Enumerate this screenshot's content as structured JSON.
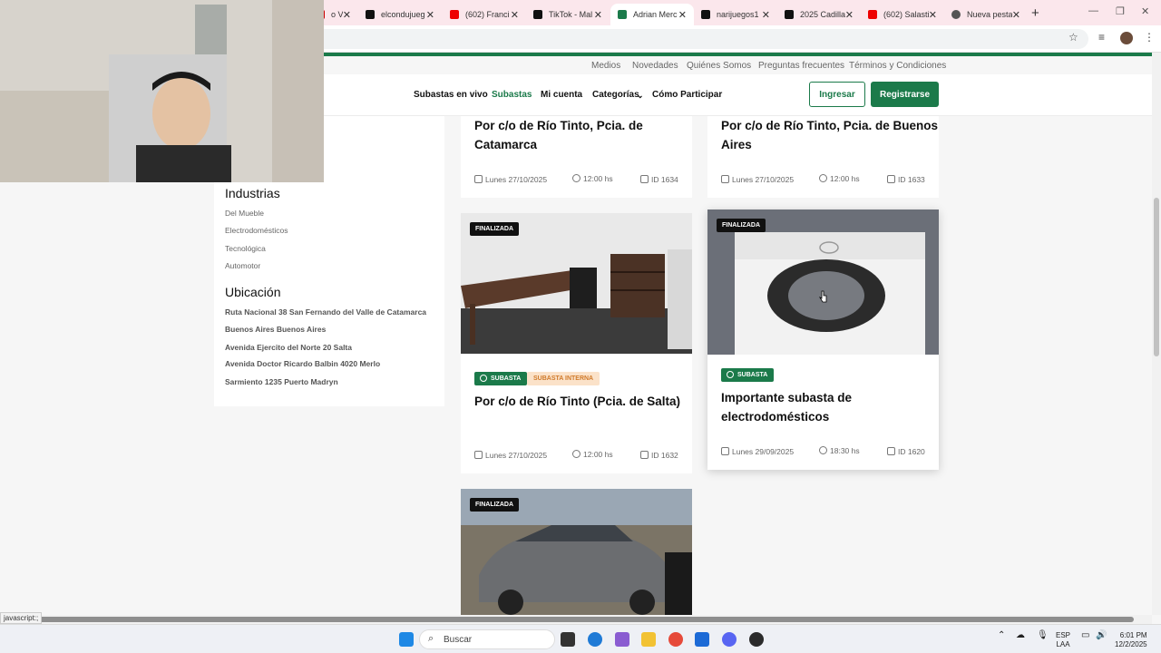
{
  "browser": {
    "tabs": [
      {
        "label": "o V",
        "color": "#c00",
        "active": false
      },
      {
        "label": "elcondujueg",
        "color": "#111",
        "active": false
      },
      {
        "label": "(602) Franci",
        "color": "#e00",
        "active": false
      },
      {
        "label": "TikTok - Mal",
        "color": "#111",
        "active": false
      },
      {
        "label": "Adrian Merc",
        "color": "#1b7a4a",
        "active": true
      },
      {
        "label": "narijuegos1",
        "color": "#111",
        "active": false
      },
      {
        "label": "2025 Cadilla",
        "color": "#111",
        "active": false
      },
      {
        "label": "(602) Salasti",
        "color": "#e00",
        "active": false
      },
      {
        "label": "Nueva pesta",
        "color": "#555",
        "active": false
      }
    ],
    "new_tab": "+",
    "status_url": "javascript:;"
  },
  "topnav": [
    "Medios",
    "Novedades",
    "Quiénes Somos",
    "Preguntas frecuentes",
    "Términos y Condiciones"
  ],
  "mainnav": {
    "items": [
      "Subastas en vivo",
      "Subastas",
      "Mi cuenta",
      "Categorías",
      "Cómo Participar"
    ],
    "login": "Ingresar",
    "register": "Registrarse"
  },
  "sidebar": {
    "industrias_title": "Industrias",
    "industrias": [
      "Del Mueble",
      "Electrodomésticos",
      "Tecnológica",
      "Automotor"
    ],
    "ubicacion_title": "Ubicación",
    "ubicaciones": [
      "Ruta Nacional 38 San Fernando del Valle de Catamarca",
      "Buenos Aires Buenos Aires",
      "Avenida Ejercito del Norte 20 Salta",
      "Avenida Doctor Ricardo Balbin 4020 Merlo",
      "Sarmiento 1235 Puerto Madryn"
    ]
  },
  "cards": [
    {
      "title_l1": "Por c/o de Río Tinto, Pcia. de",
      "title_l2": "Catamarca",
      "date": "Lunes 27/10/2025",
      "time": "12:00 hs",
      "id": "ID 1634"
    },
    {
      "title_l1": "Por c/o de Río Tinto, Pcia. de Buenos",
      "title_l2": "Aires",
      "date": "Lunes 27/10/2025",
      "time": "12:00 hs",
      "id": "ID 1633"
    },
    {
      "status": "FINALIZADA",
      "badge": "SUBASTA",
      "badge2": "SUBASTA INTERNA",
      "title_l1": "Por c/o de Río Tinto (Pcia. de Salta)",
      "date": "Lunes 27/10/2025",
      "time": "12:00 hs",
      "id": "ID 1632"
    },
    {
      "status": "FINALIZADA",
      "badge": "SUBASTA",
      "title_l1": "Importante subasta de",
      "title_l2": "electrodomésticos",
      "date": "Lunes 29/09/2025",
      "time": "18:30 hs",
      "id": "ID 1620"
    },
    {
      "status": "FINALIZADA"
    }
  ],
  "taskbar": {
    "search": "Buscar",
    "lang": "ESP",
    "lang2": "LAA",
    "time": "6:01 PM",
    "date": "12/2/2025"
  }
}
